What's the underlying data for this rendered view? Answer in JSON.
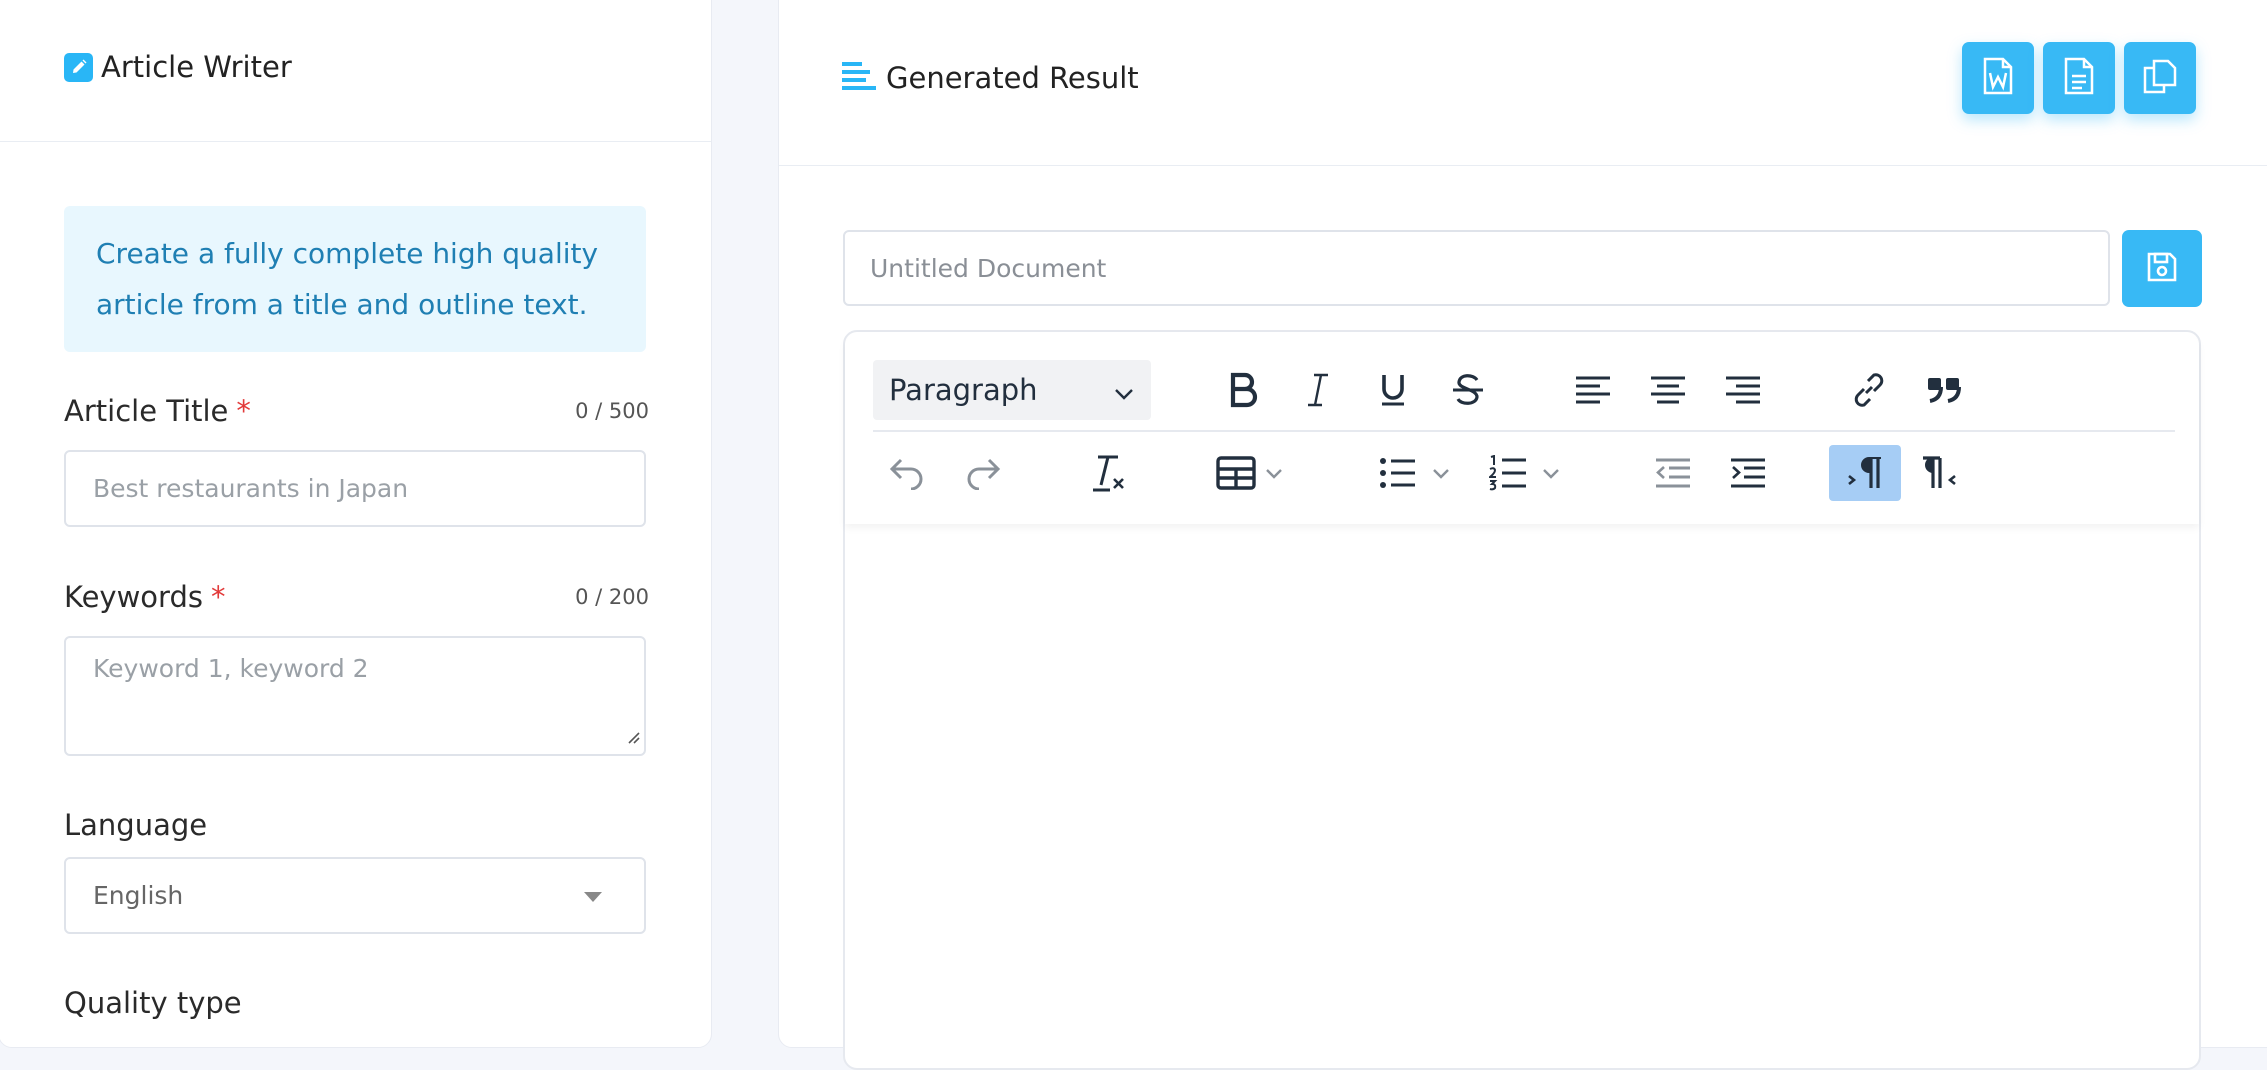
{
  "left": {
    "title": "Article Writer",
    "info": "Create a fully complete high quality article from a title and outline text.",
    "article_title": {
      "label": "Article Title",
      "required_mark": "*",
      "counter": "0 / 500",
      "placeholder": "Best restaurants in Japan"
    },
    "keywords": {
      "label": "Keywords",
      "required_mark": "*",
      "counter": "0 / 200",
      "placeholder": "Keyword 1, keyword 2"
    },
    "language": {
      "label": "Language",
      "value": "English"
    },
    "quality": {
      "label": "Quality type"
    }
  },
  "right": {
    "title": "Generated Result",
    "doc_title_placeholder": "Untitled Document",
    "editor": {
      "block_format": "Paragraph"
    }
  },
  "icons": [
    "pencil-icon",
    "list-lines-icon",
    "word-doc-icon",
    "text-doc-icon",
    "copy-icon",
    "save-icon",
    "bold-icon",
    "italic-icon",
    "underline-icon",
    "strikethrough-icon",
    "align-left-icon",
    "align-center-icon",
    "align-right-icon",
    "link-icon",
    "blockquote-icon",
    "undo-icon",
    "redo-icon",
    "clear-format-icon",
    "table-icon",
    "bullet-list-icon",
    "numbered-list-icon",
    "outdent-icon",
    "indent-icon",
    "ltr-icon",
    "rtl-icon"
  ],
  "colors": {
    "accent": "#38b9f5",
    "info_bg": "#e8f7fe",
    "info_text": "#1f7fb3",
    "required": "#e23a3a",
    "active_button": "#a6cdf5"
  }
}
